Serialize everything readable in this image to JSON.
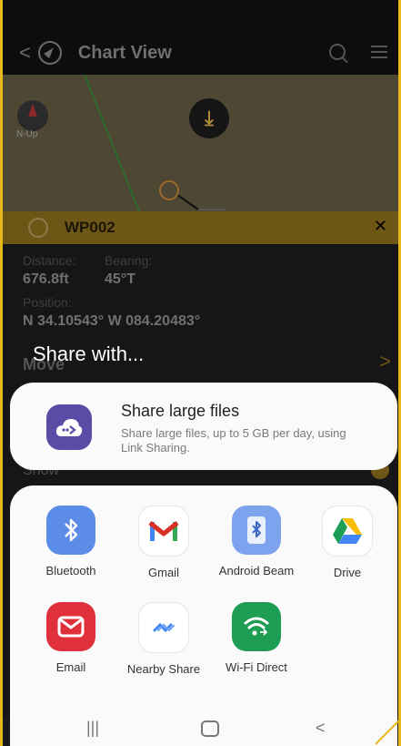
{
  "app": {
    "title": "Chart View",
    "map_compass_label": "N-Up",
    "waypoint_name": "WP002",
    "close_glyph": "✕",
    "distance_label": "Distance:",
    "distance_value": "676.8ft",
    "bearing_label": "Bearing:",
    "bearing_value": "45°T",
    "position_label": "Position:",
    "position_value": "N 34.10543° W 084.20483°",
    "move_label": "Move",
    "show_label": "Show"
  },
  "share": {
    "title": "Share with...",
    "large_files": {
      "title": "Share large files",
      "subtitle": "Share large files, up to 5 GB per day, using Link Sharing."
    },
    "apps": [
      {
        "label": "Bluetooth",
        "icon": "bluetooth-icon"
      },
      {
        "label": "Gmail",
        "icon": "gmail-icon"
      },
      {
        "label": "Android Beam",
        "icon": "android-beam-icon"
      },
      {
        "label": "Drive",
        "icon": "drive-icon"
      },
      {
        "label": "Email",
        "icon": "email-icon"
      },
      {
        "label": "Nearby Share",
        "icon": "nearby-share-icon"
      },
      {
        "label": "Wi-Fi Direct",
        "icon": "wifi-direct-icon"
      }
    ]
  },
  "nav": {
    "recents_glyph": "|||",
    "back_glyph": "<"
  },
  "colors": {
    "accent": "#e8b71b",
    "share_large_icon": "#5b4aa6",
    "bluetooth": "#4f86e8",
    "gmail_red": "#d93025",
    "email": "#e0303c",
    "wifi_direct": "#1e9e55"
  }
}
